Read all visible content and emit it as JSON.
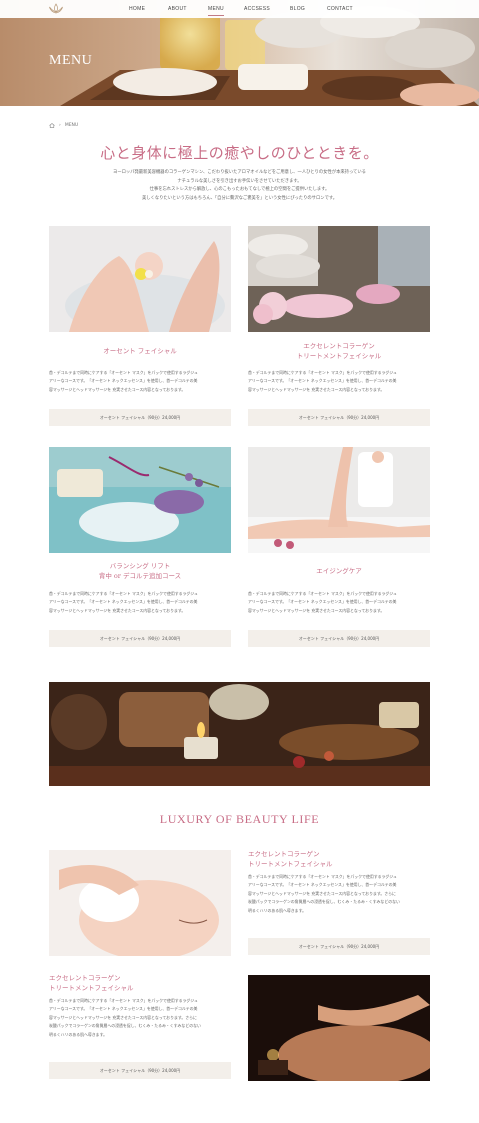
{
  "nav": {
    "logo_icon": "lotus-icon",
    "items": [
      "HOME",
      "ABOUT",
      "MENU",
      "ACCSESS",
      "BLOG",
      "CONTACT"
    ],
    "active": "MENU"
  },
  "hero": {
    "title": "MENU"
  },
  "breadcrumb": {
    "home_icon": "home-icon",
    "current": "MENU"
  },
  "headline": "心と身体に極上の癒やしのひとときを。",
  "intro": [
    "ヨーロッパ発最新美容機器のコラーゲンマシン、こだわり抜いたアロマオイルなどをご用意し、一人ひとりの女性が本来持っている",
    "ナチュラルな美しさを引き出すお手伝いをさせていただきます。",
    "仕事を忘れストレスから解放し、心のこもったおもてなしで極上の空間をご提供いたします。",
    "美しくなりたいという方はもちろん、「自分に贅沢なご褒美を」という女性にぴったりのサロンです。"
  ],
  "cards": [
    {
      "title": "オーセント フェイシャル",
      "text": [
        "首・デコルテまで同時にケアする「オーセント マスク」をパックで使用するラグジュ",
        "アリーなコースです。「オーセント ネックエッセンス」を使用し、首～デコルテの美",
        "容マッサージとヘッドマッサージを 充実させたコース内容となっております。"
      ],
      "price": "オーセント フェイシャル（90分）24,000円"
    },
    {
      "title": "エクセレントコラーゲン\nトリートメントフェイシャル",
      "text": [
        "首・デコルテまで同時にケアする「オーセント マスク」をパックで使用するラグジュ",
        "アリーなコースです。「オーセント ネックエッセンス」を使用し、首～デコルテの美",
        "容マッサージとヘッドマッサージを 充実させたコース内容となっております。"
      ],
      "price": "オーセント フェイシャル（90分）24,000円"
    },
    {
      "title": "バランシング リフト\n背中 or デコルテ追加コース",
      "text": [
        "首・デコルテまで同時にケアする「オーセント マスク」をパックで使用するラグジュ",
        "アリーなコースです。「オーセント ネックエッセンス」を使用し、首～デコルテの美",
        "容マッサージとヘッドマッサージを 充実させたコース内容となっております。"
      ],
      "price": "オーセント フェイシャル（90分）24,000円"
    },
    {
      "title": "エイジングケア",
      "text": [
        "首・デコルテまで同時にケアする「オーセント マスク」をパックで使用するラグジュ",
        "アリーなコースです。「オーセント ネックエッセンス」を使用し、首～デコルテの美",
        "容マッサージとヘッドマッサージを 充実させたコース内容となっております。"
      ],
      "price": "オーセント フェイシャル（90分）24,000円"
    }
  ],
  "luxury": {
    "heading": "LUXURY OF BEAUTY LIFE",
    "items": [
      {
        "title": "エクセレントコラーゲン\nトリートメントフェイシャル",
        "text": [
          "首・デコルテまで同時にケアする「オーセント マスク」をパックで使用するラグジュ",
          "アリーなコースです。「オーセント ネックエッセンス」を使用し、首～デコルテの美",
          "容マッサージとヘッドマッサージを 充実させたコース内容となっております。さらに",
          "炭酸パックでコラーゲンの角質層への浸透を促し、むくみ・たるみ・くすみなどのない",
          "明るくハリのある肌へ導きます。"
        ],
        "price": "オーセント フェイシャル（90分）24,000円"
      },
      {
        "title": "エクセレントコラーゲン\nトリートメントフェイシャル",
        "text": [
          "首・デコルテまで同時にケアする「オーセント マスク」をパックで使用するラグジュ",
          "アリーなコースです。「オーセント ネックエッセンス」を使用し、首～デコルテの美",
          "容マッサージとヘッドマッサージを 充実させたコース内容となっております。さらに",
          "炭酸パックでコラーゲンの角質層への浸透を促し、むくみ・たるみ・くすみなどのない",
          "明るくハリのある肌へ導きます。"
        ],
        "price": "オーセント フェイシャル（90分）24,000円"
      }
    ]
  },
  "colors": {
    "accent": "#c86d86",
    "button_bg": "#f3efea",
    "text": "#666666"
  }
}
